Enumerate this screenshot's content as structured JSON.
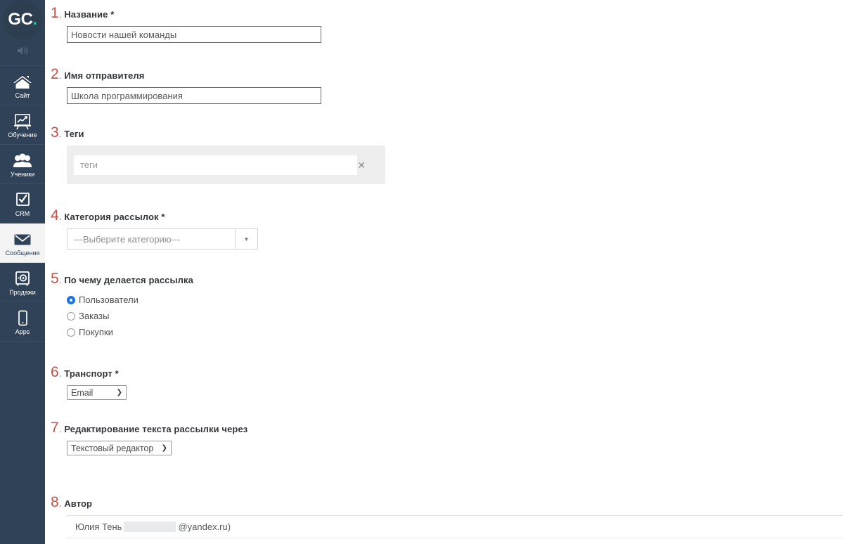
{
  "sidebar": {
    "logo": {
      "part1": "GC",
      "part2": "."
    },
    "sound_icon": "speaker-icon",
    "items": [
      {
        "label": "Сайт",
        "icon": "home-icon",
        "active": false
      },
      {
        "label": "Обучение",
        "icon": "presentation-icon",
        "active": false
      },
      {
        "label": "Ученики",
        "icon": "users-icon",
        "active": false
      },
      {
        "label": "CRM",
        "icon": "checkbox-icon",
        "active": false
      },
      {
        "label": "Сообщения",
        "icon": "envelope-icon",
        "active": true
      },
      {
        "label": "Продажи",
        "icon": "safe-icon",
        "active": false
      },
      {
        "label": "Apps",
        "icon": "phone-icon",
        "active": false
      }
    ]
  },
  "form": {
    "required_mark": "*",
    "fields": [
      {
        "num": "1",
        "label": "Название",
        "required": true,
        "type": "text",
        "value": "Новости нашей команды"
      },
      {
        "num": "2",
        "label": "Имя отправителя",
        "required": false,
        "type": "text",
        "value": "Школа программирования"
      },
      {
        "num": "3",
        "label": "Теги",
        "required": false,
        "type": "tags",
        "placeholder": "теги",
        "value": "",
        "clear_icon": "close-icon"
      },
      {
        "num": "4",
        "label": "Категория рассылок",
        "required": true,
        "type": "select",
        "value": "---Выберите категорию---",
        "caret_icon": "caret-down-icon"
      },
      {
        "num": "5",
        "label": "По чему делается рассылка",
        "required": false,
        "type": "radio",
        "options": [
          {
            "label": "Пользователи",
            "selected": true
          },
          {
            "label": "Заказы",
            "selected": false
          },
          {
            "label": "Покупки",
            "selected": false
          }
        ]
      },
      {
        "num": "6",
        "label": "Транспорт",
        "required": true,
        "type": "native-select",
        "value": "Email",
        "chevron_icon": "chevron-down-icon"
      },
      {
        "num": "7",
        "label": "Редактирование текста рассылки через",
        "required": false,
        "type": "native-select",
        "value": "Текстовый редактор",
        "chevron_icon": "chevron-down-icon"
      },
      {
        "num": "8",
        "label": "Автор",
        "required": false,
        "type": "author",
        "name": "Юлия Тень",
        "redacted": true,
        "email_suffix": "@yandex.ru)"
      }
    ]
  },
  "colors": {
    "sidebar_bg": "#2f4257",
    "sidebar_active_bg": "#f4f4f4",
    "logo_accent": "#30bfa8",
    "number_red": "#c7514b",
    "radio_blue": "#1a73e8"
  }
}
